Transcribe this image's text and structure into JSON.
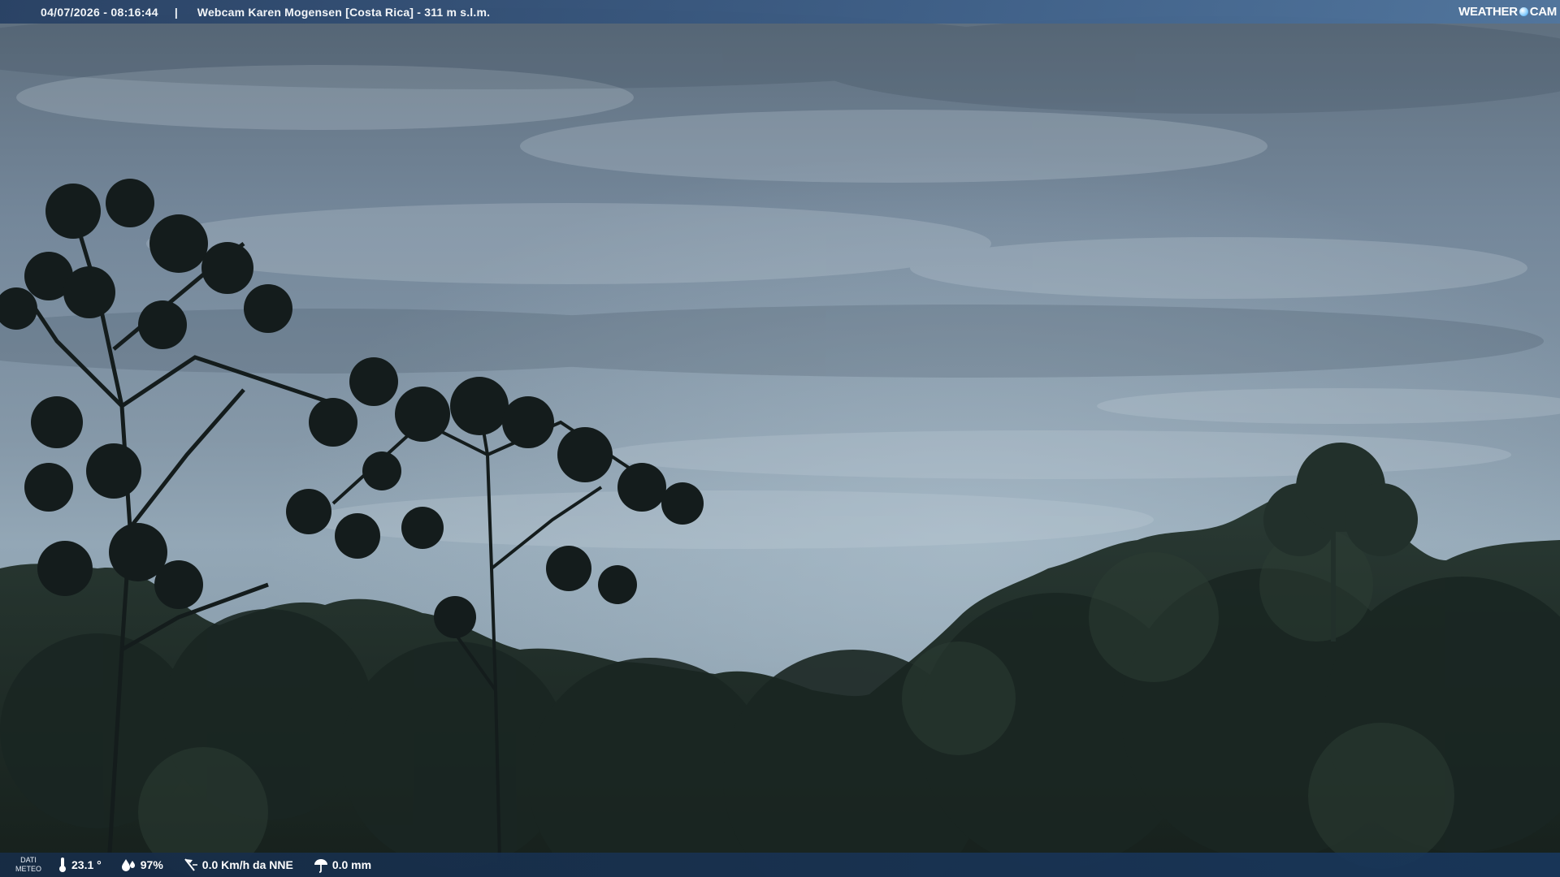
{
  "topbar": {
    "timestamp": "04/07/2026 - 08:16:44",
    "separator": "|",
    "title": "Webcam Karen Mogensen [Costa Rica]  - 311 m s.l.m."
  },
  "logo": {
    "text_left": "WEATHER",
    "text_right": "CAM"
  },
  "bottombar": {
    "dati_line1": "DATI",
    "dati_line2": "METEO",
    "temperature": "23.1 °",
    "humidity": "97%",
    "wind": "0.0 Km/h da NNE",
    "rain": "0.0 mm"
  },
  "icons": {
    "temperature": "thermometer-icon",
    "humidity": "humidity-drop-icon",
    "wind": "wind-vane-icon",
    "rain": "rain-umbrella-icon"
  },
  "colors": {
    "topbar": "#2f4f78",
    "bottombar": "#1a3658",
    "sky": "#7f8f9e",
    "foliage": "#1f2b28"
  }
}
